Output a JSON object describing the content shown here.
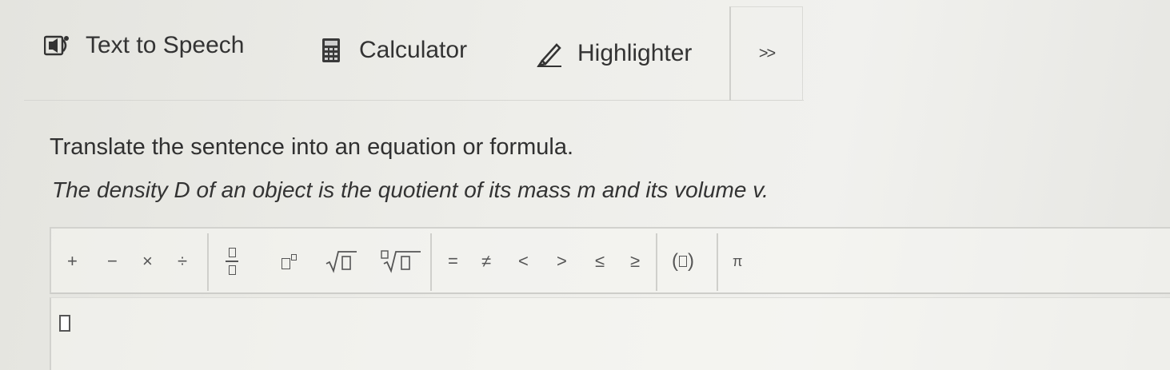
{
  "toolbar": {
    "tts_label": "Text to Speech",
    "calculator_label": "Calculator",
    "highlighter_label": "Highlighter",
    "more_label": ">>"
  },
  "question": {
    "instruction": "Translate the sentence into an equation or formula.",
    "sentence": "The density D of an object is the quotient of its mass m and its volume v."
  },
  "editor": {
    "plus": "+",
    "minus": "−",
    "times": "×",
    "divide": "÷",
    "equals": "=",
    "not_equal": "≠",
    "less": "<",
    "greater": ">",
    "leq": "≤",
    "geq": "≥",
    "pi": "π"
  },
  "colors": {
    "background": "#ecece8",
    "text": "#2d2d2d",
    "border": "#d2d2ce"
  }
}
